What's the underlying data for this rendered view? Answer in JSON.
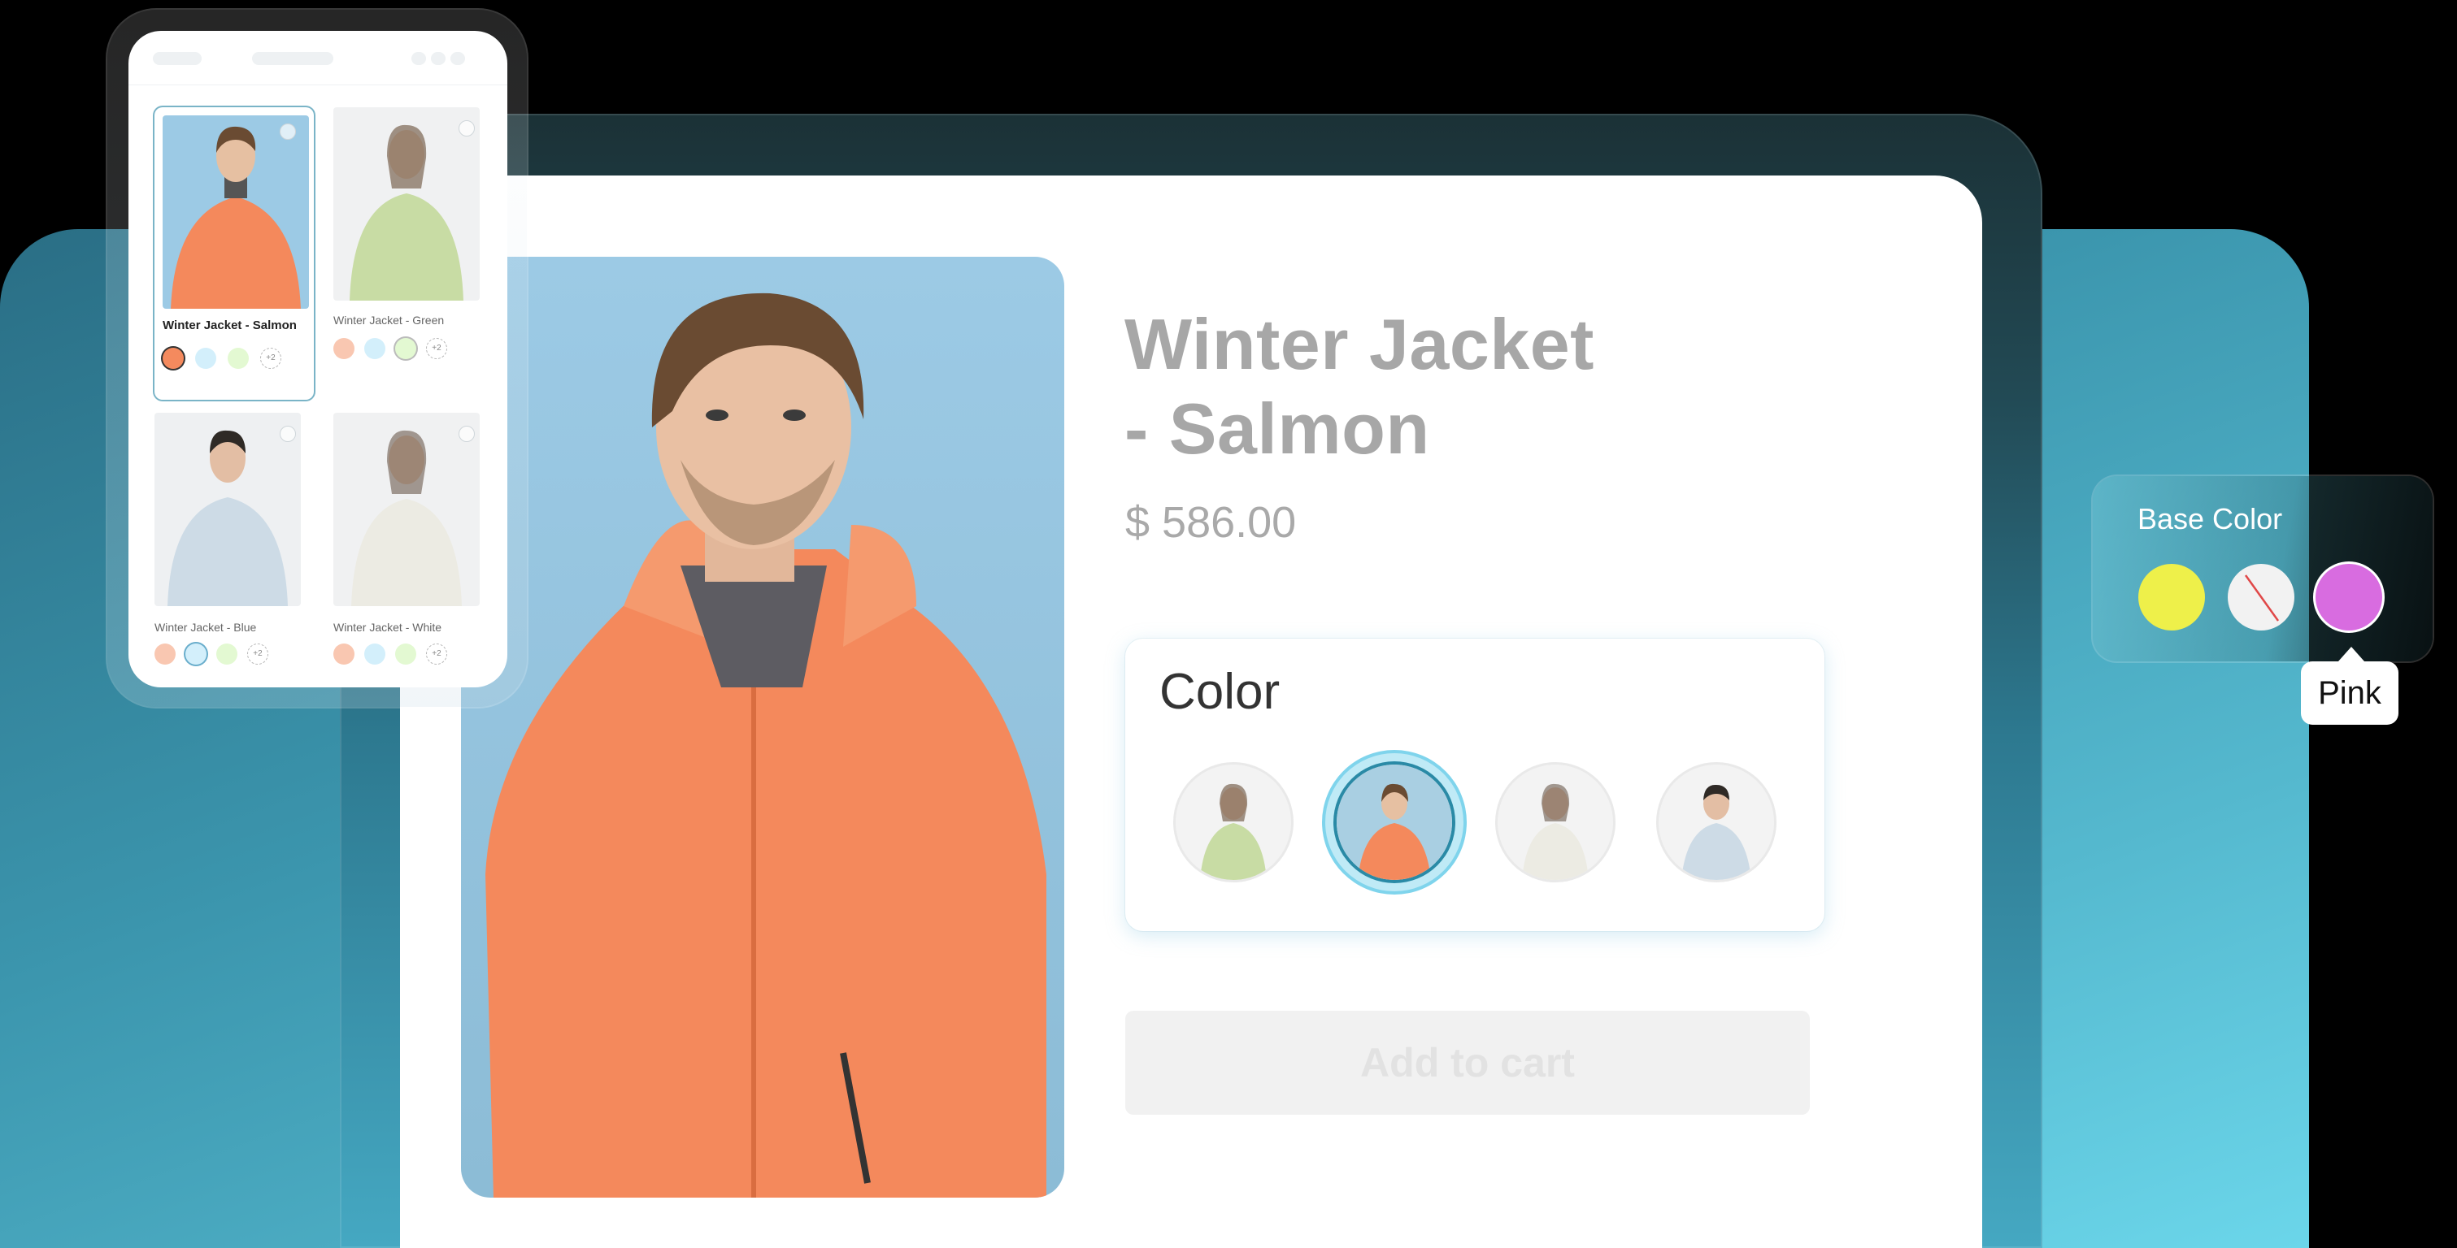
{
  "product": {
    "title_line1": "Winter Jacket",
    "title_line2": "- Salmon",
    "price": "$ 586.00",
    "color_section_title": "Color",
    "add_to_cart_label": "Add to cart",
    "color_options": [
      "green",
      "salmon",
      "white",
      "blue"
    ],
    "selected_color": "salmon"
  },
  "phone_list": {
    "items": [
      {
        "name": "Winter Jacket - Salmon",
        "more": "+2"
      },
      {
        "name": "Winter Jacket - Green",
        "more": "+2"
      },
      {
        "name": "Winter Jacket - Blue",
        "more": "+2"
      },
      {
        "name": "Winter Jacket - White",
        "more": "+2"
      }
    ],
    "swatch_colors": [
      "#f9c7b1",
      "#d3effb",
      "#e3f9d2"
    ]
  },
  "base_color": {
    "label": "Base Color",
    "options": [
      "yellow",
      "none",
      "pink"
    ],
    "option_colors": [
      "#eef04a",
      "#f2f2f2",
      "#d86ce0"
    ],
    "tooltip": "Pink"
  },
  "colors": {
    "accent_teal": "#2a8aa6",
    "jacket_salmon": "#f48a5e",
    "jacket_green": "#c8dca4",
    "jacket_white": "#ecebe3",
    "jacket_blue": "#cddbe6"
  }
}
